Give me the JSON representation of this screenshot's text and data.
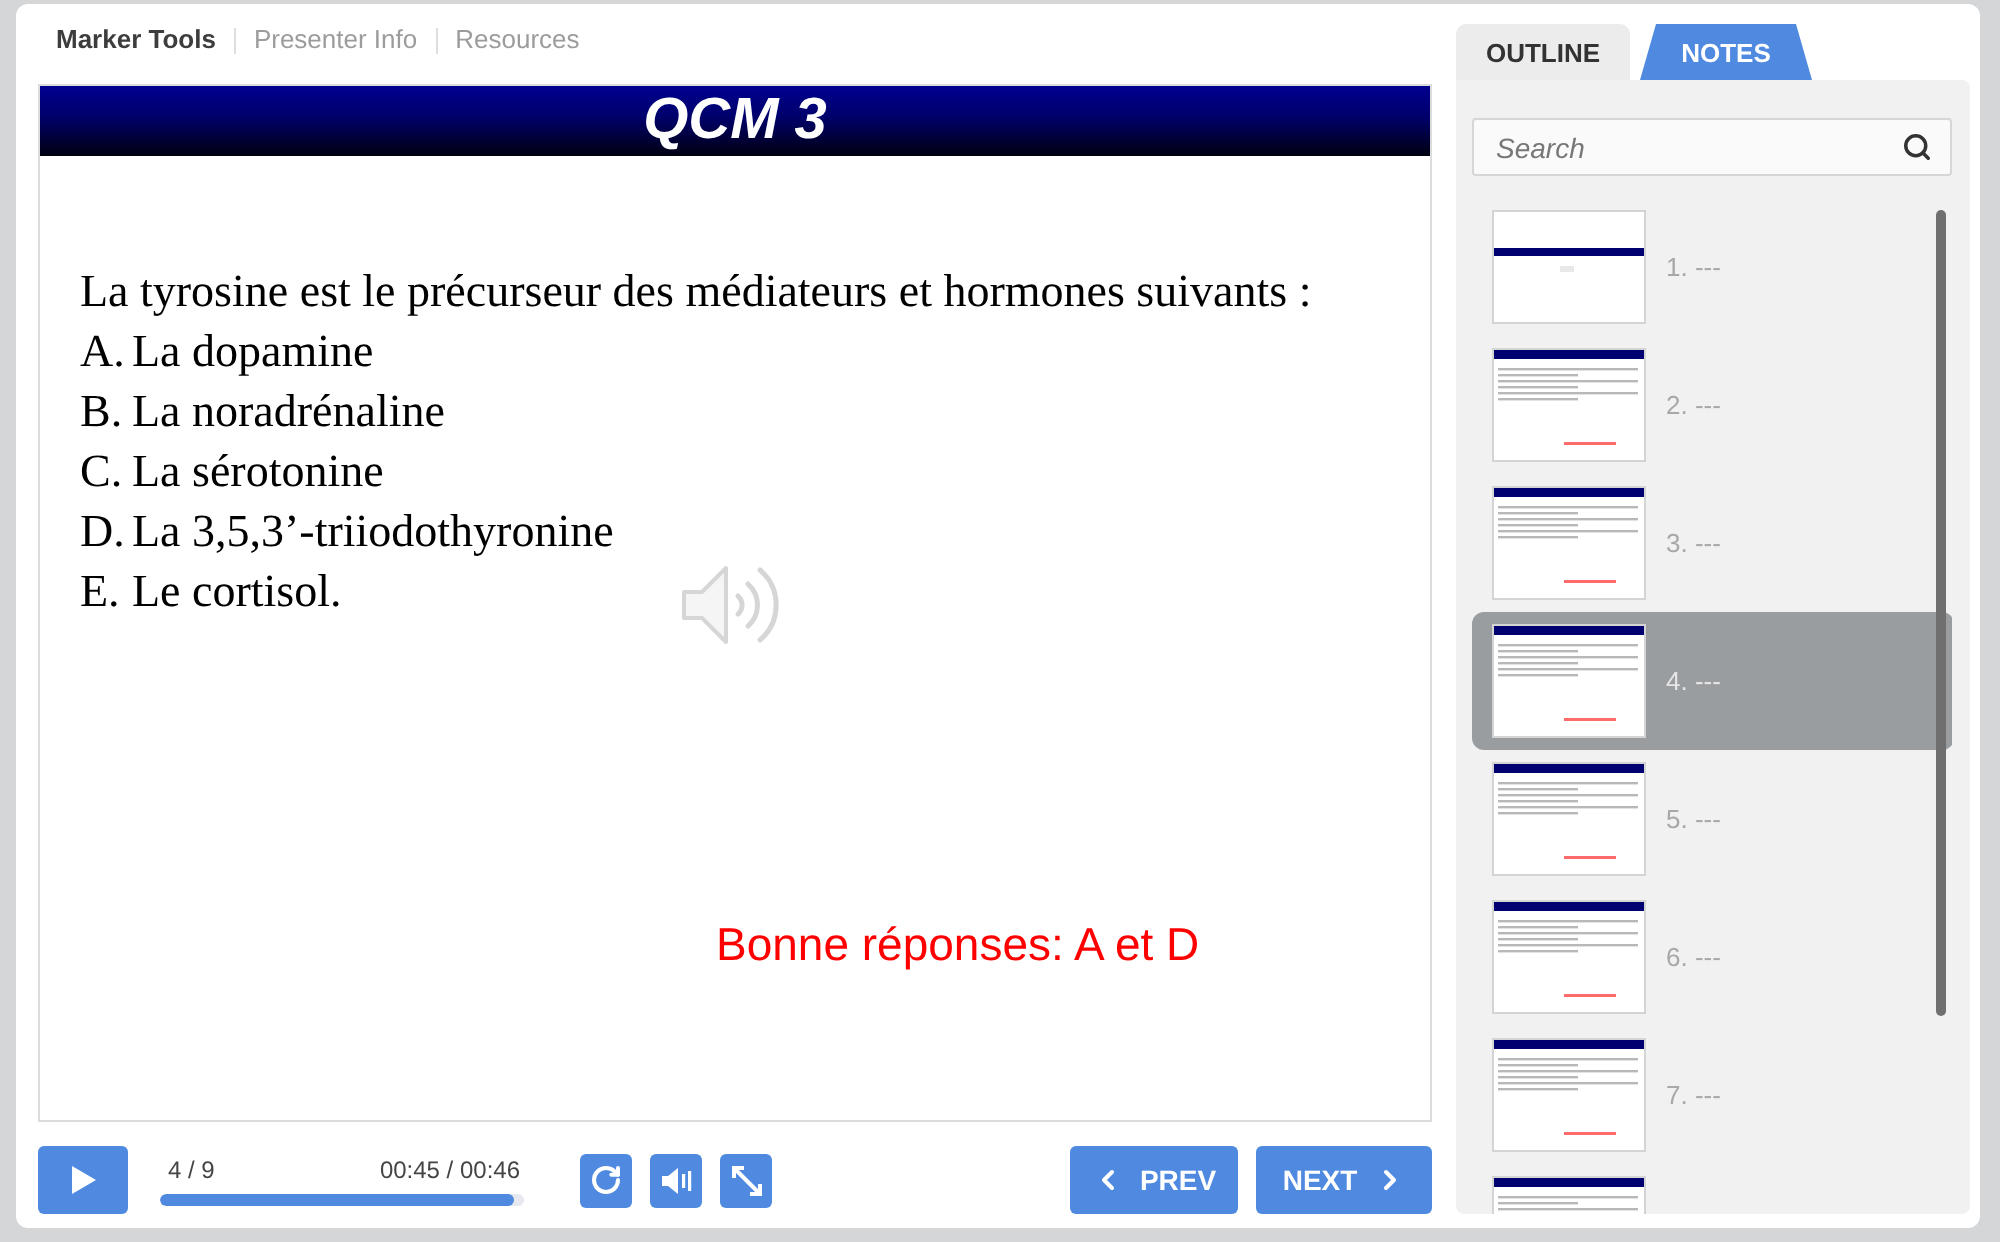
{
  "nav": [
    {
      "label": "Marker Tools",
      "selected": true
    },
    {
      "label": "Presenter Info",
      "selected": false
    },
    {
      "label": "Resources",
      "selected": false
    }
  ],
  "slide": {
    "title": "QCM 3",
    "question": "La tyrosine est le précurseur des médiateurs et hormones suivants :",
    "options": [
      {
        "letter": "A.",
        "text": "La dopamine"
      },
      {
        "letter": "B.",
        "text": "La noradrénaline"
      },
      {
        "letter": "C.",
        "text": "La sérotonine"
      },
      {
        "letter": "D.",
        "text": "La 3,5,3’-triiodothyronine"
      },
      {
        "letter": "E.",
        "text": "Le cortisol."
      }
    ],
    "answer": "Bonne réponses: A et D"
  },
  "player": {
    "counter": "4 / 9",
    "time": "00:45 / 00:46",
    "progress": {
      "level": 0.97
    },
    "prev": "PREV",
    "next": "NEXT"
  },
  "sidebar": {
    "tabs": [
      {
        "label": "OUTLINE",
        "selected": true
      },
      {
        "label": "NOTES",
        "selected": false
      }
    ],
    "search": {
      "placeholder": "Search"
    },
    "slides": [
      {
        "kind": "title",
        "label": "1. ---",
        "selected": false
      },
      {
        "kind": "question",
        "label": "2. ---",
        "selected": false
      },
      {
        "kind": "question",
        "label": "3. ---",
        "selected": false
      },
      {
        "kind": "question",
        "label": "4. ---",
        "selected": true
      },
      {
        "kind": "question",
        "label": "5. ---",
        "selected": false
      },
      {
        "kind": "question",
        "label": "6. ---",
        "selected": false
      },
      {
        "kind": "question",
        "label": "7. ---",
        "selected": false
      },
      {
        "kind": "question",
        "selected": false
      }
    ]
  }
}
